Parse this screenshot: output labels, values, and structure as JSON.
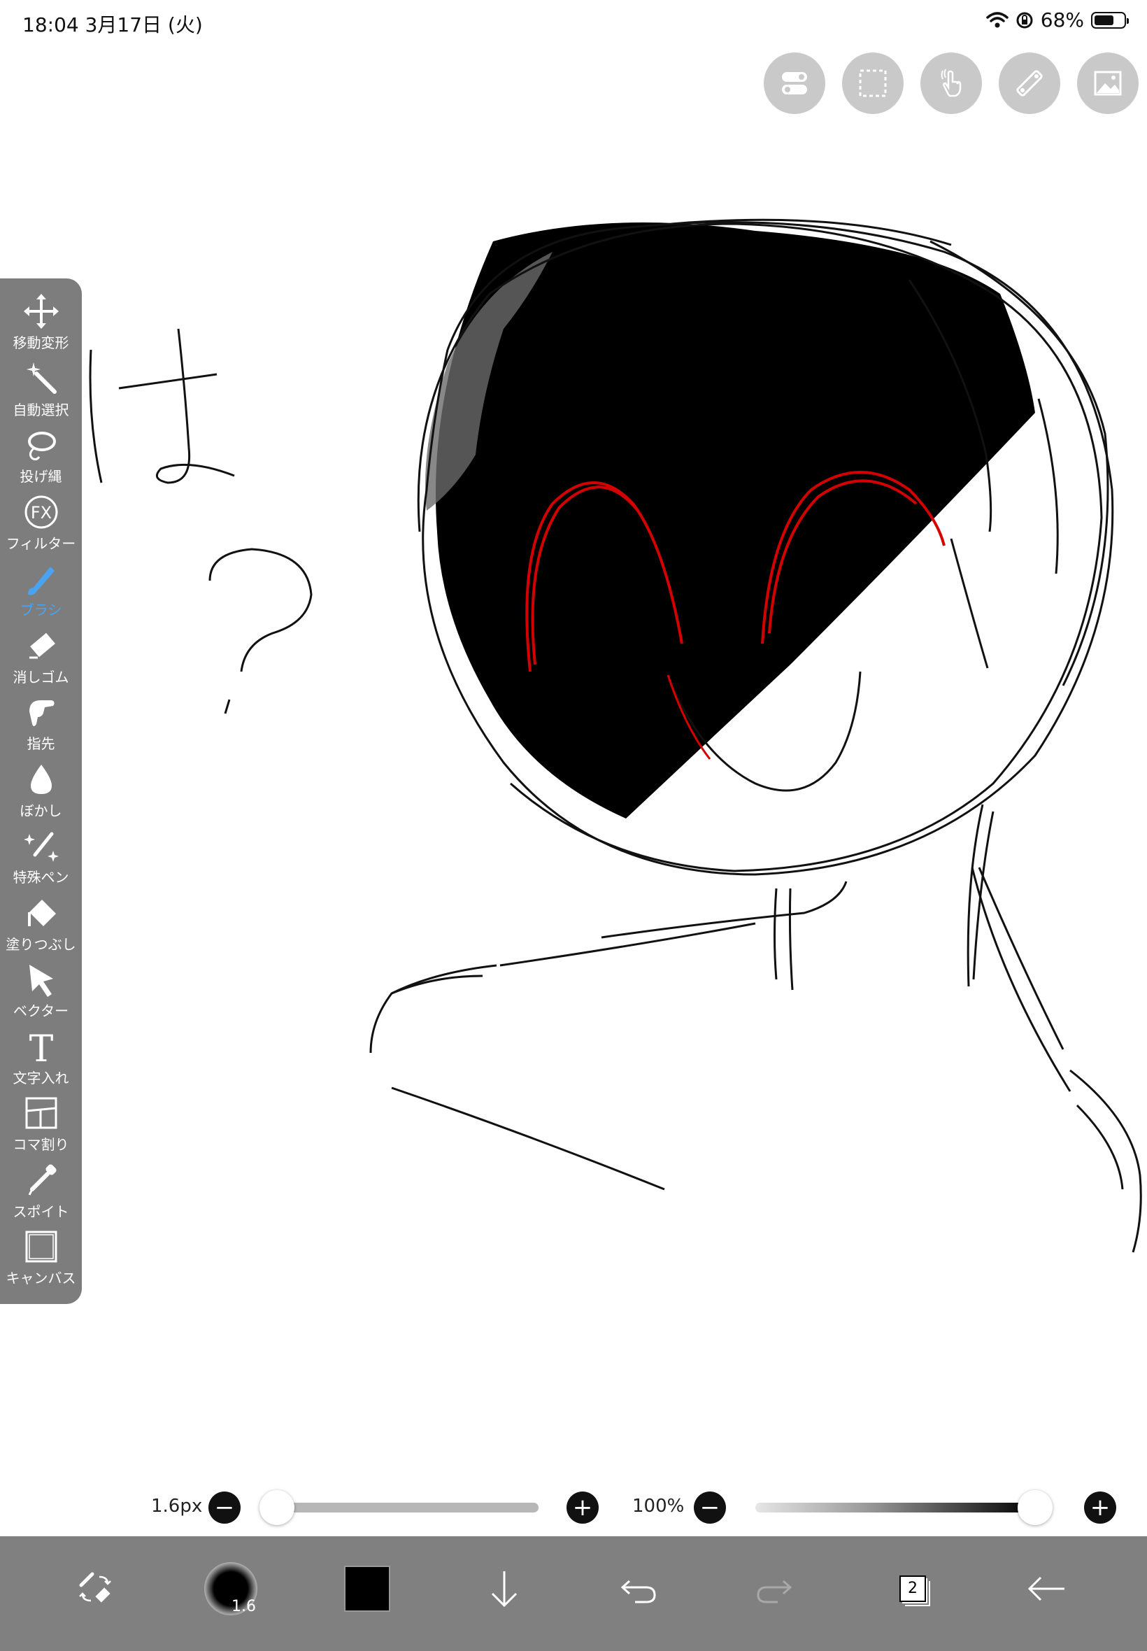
{
  "status_bar": {
    "time_date": "18:04   3月17日 (火)",
    "battery_percent": "68%",
    "battery_level": 0.68
  },
  "top_tools": [
    {
      "name": "toggle-icon"
    },
    {
      "name": "selection-icon"
    },
    {
      "name": "hand-gesture-icon"
    },
    {
      "name": "ruler-icon"
    },
    {
      "name": "material-icon"
    }
  ],
  "canvas": {
    "drawn_text": "は？"
  },
  "palette": {
    "tools": [
      {
        "label": "移動変形",
        "icon": "move-icon"
      },
      {
        "label": "自動選択",
        "icon": "magic-wand-icon"
      },
      {
        "label": "投げ縄",
        "icon": "lasso-icon"
      },
      {
        "label": "フィルター",
        "icon": "fx-icon",
        "icon_text": "FX"
      },
      {
        "label": "ブラシ",
        "icon": "brush-icon",
        "active": true
      },
      {
        "label": "消しゴム",
        "icon": "eraser-icon"
      },
      {
        "label": "指先",
        "icon": "finger-icon"
      },
      {
        "label": "ぼかし",
        "icon": "drop-icon"
      },
      {
        "label": "特殊ペン",
        "icon": "sparkle-pen-icon"
      },
      {
        "label": "塗りつぶし",
        "icon": "bucket-icon"
      },
      {
        "label": "ベクター",
        "icon": "vector-arrow-icon"
      },
      {
        "label": "文字入れ",
        "icon": "text-icon",
        "icon_text": "T"
      },
      {
        "label": "コマ割り",
        "icon": "panel-icon"
      },
      {
        "label": "スポイト",
        "icon": "eyedropper-icon"
      },
      {
        "label": "キャンバス",
        "icon": "canvas-icon"
      }
    ]
  },
  "sliders": {
    "size_label": "1.6px",
    "size_value_fraction": 0.0,
    "opacity_label": "100%",
    "opacity_value_fraction": 1.0,
    "minus": "−",
    "plus": "+"
  },
  "bottom_bar": {
    "brush_size": "1.6",
    "current_color": "#000000",
    "layer_count": "2"
  },
  "colors": {
    "palette_bg": "#7d7d7d",
    "active_tool": "#4aa3f0",
    "bottom_bar": "#808080",
    "sketch_red": "#d40000"
  }
}
